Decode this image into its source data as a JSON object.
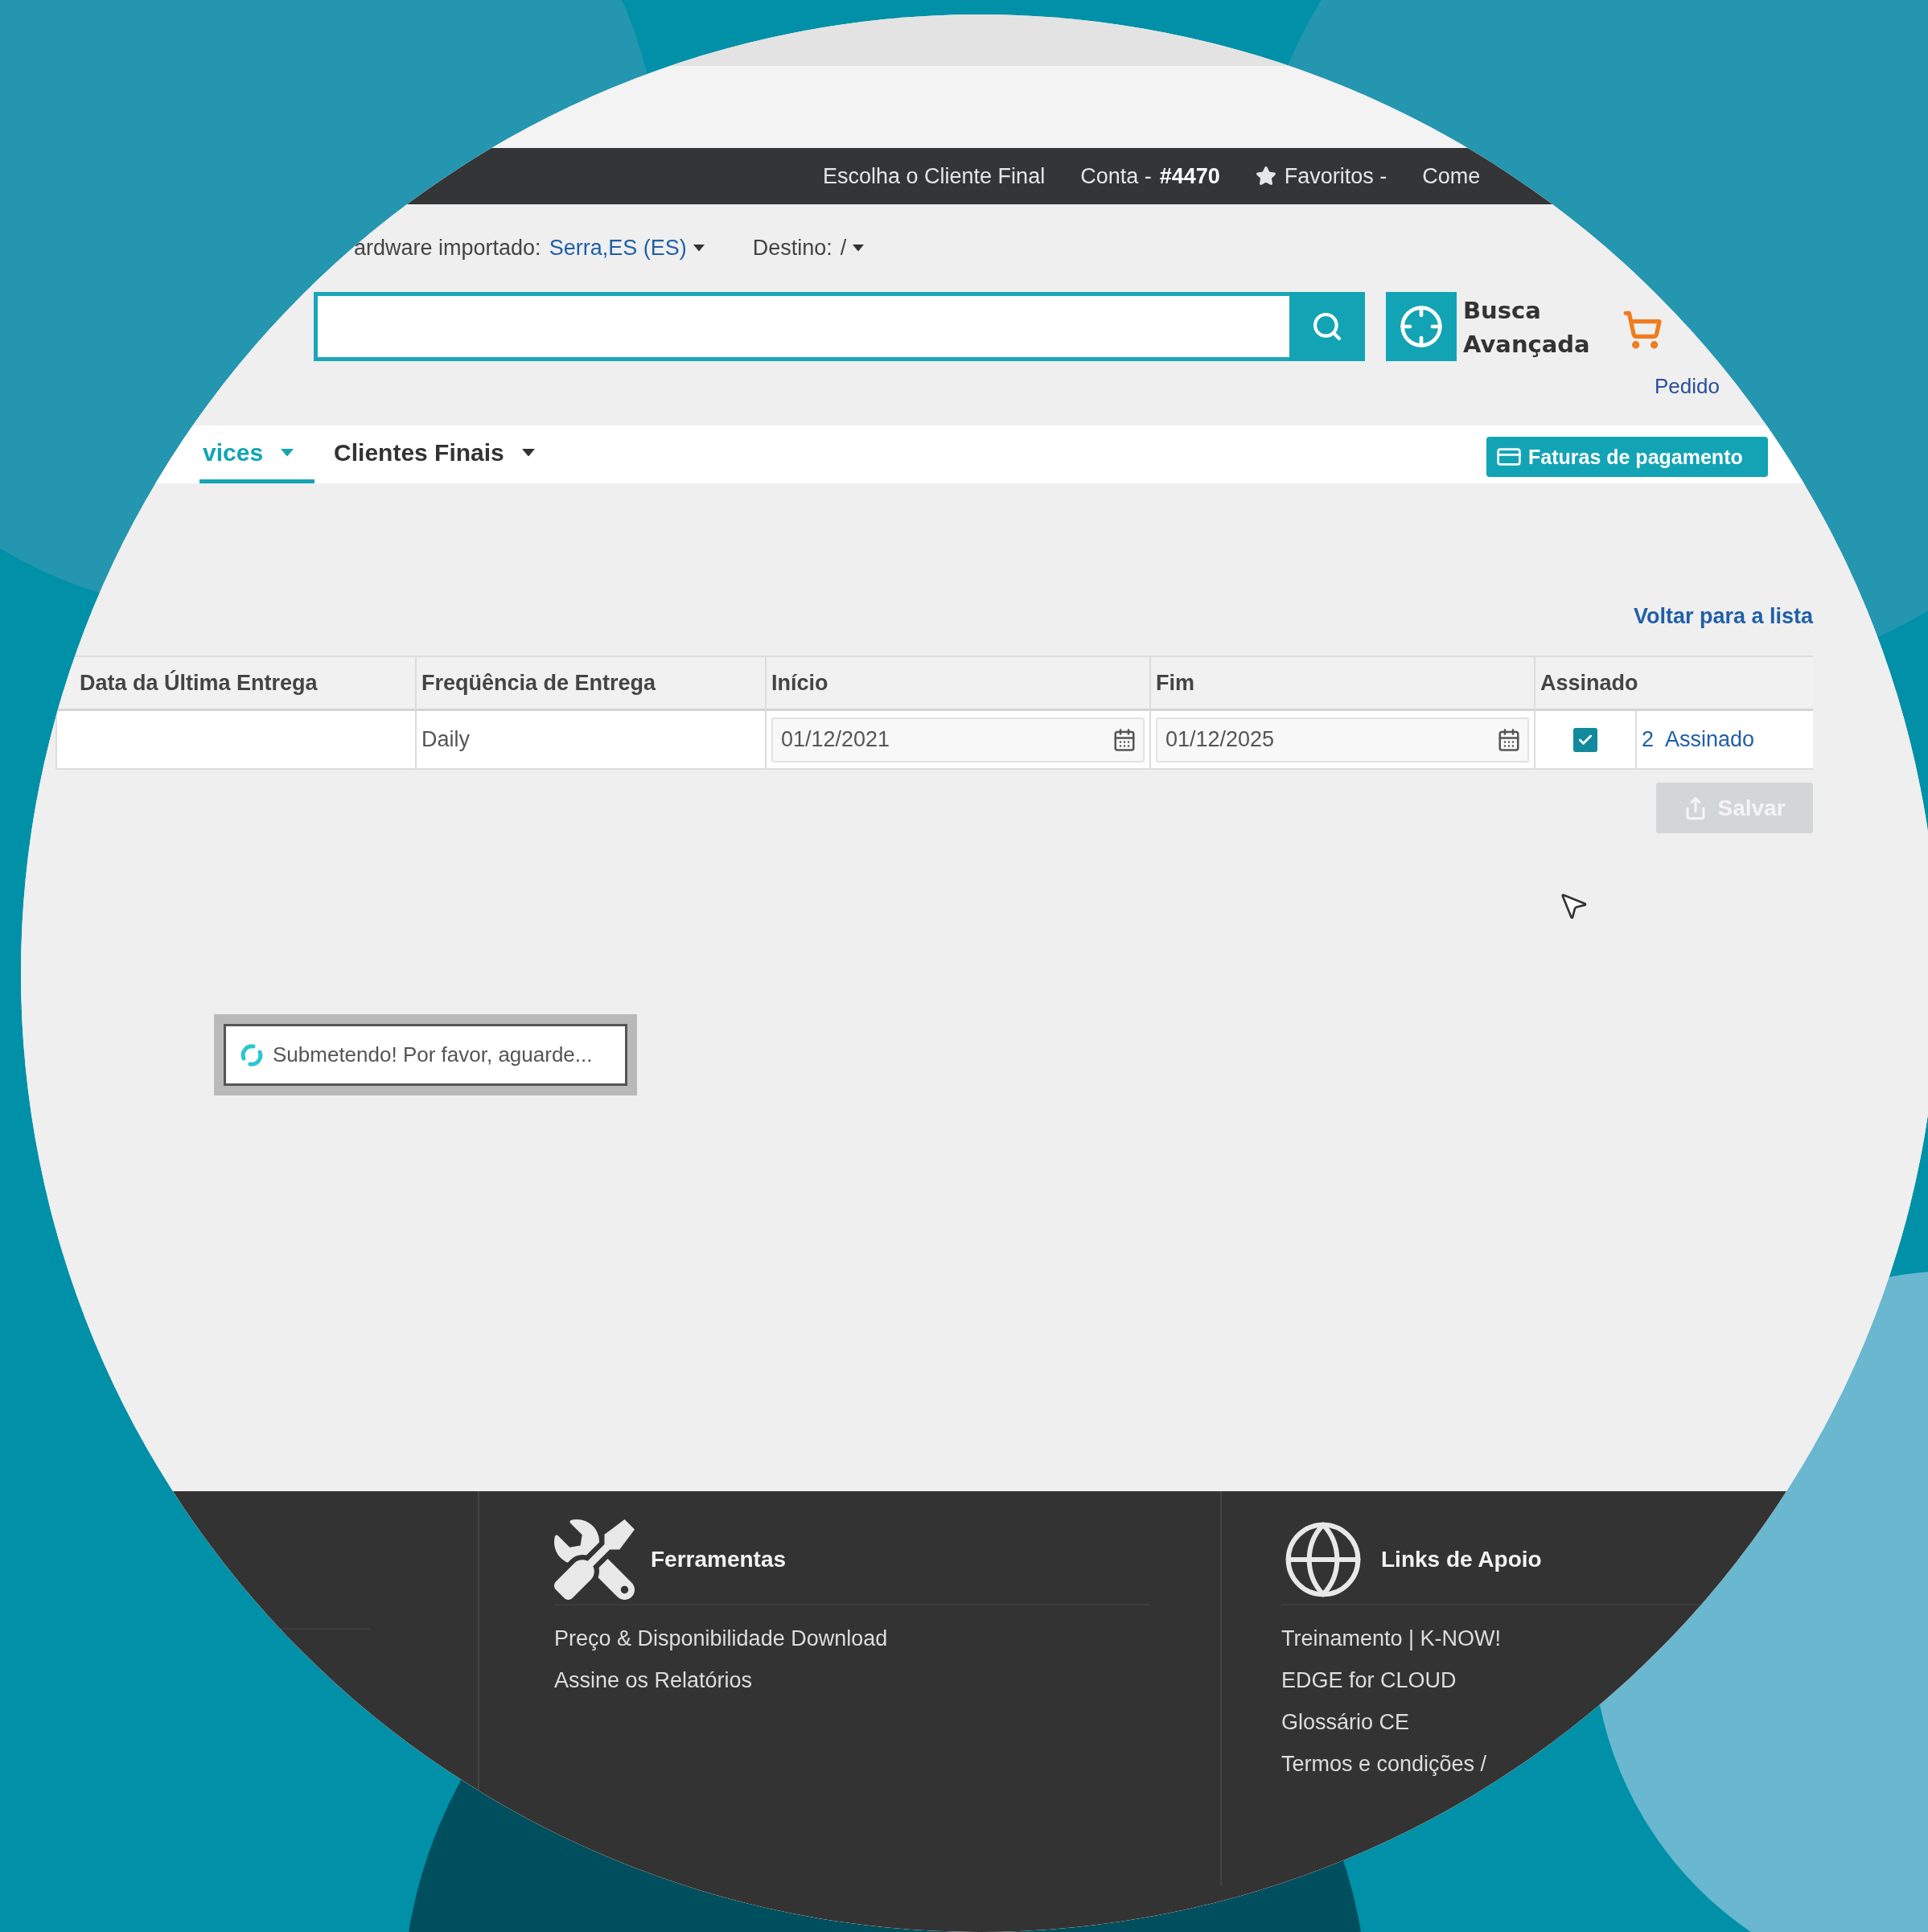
{
  "top_bar": {
    "items": [
      {
        "kind": "link",
        "label": "Escolha o Cliente Final"
      },
      {
        "kind": "account",
        "label": "Conta -",
        "value": "#4470"
      },
      {
        "kind": "favorites",
        "label": "Favoritos -"
      },
      {
        "kind": "link",
        "label": "Come"
      }
    ]
  },
  "location_bar": {
    "hardware_label": "ardware importado:",
    "hardware_value": "Serra,ES (ES)",
    "destination_label": "Destino:",
    "destination_value": "/"
  },
  "search": {
    "advanced_label": "Busca Avançada"
  },
  "cart": {
    "label": "Pedido"
  },
  "nav": {
    "tabs": [
      {
        "label": "vices",
        "selected": true
      },
      {
        "label": "Clientes Finais",
        "selected": false
      }
    ],
    "invoices_button": "Faturas de pagamento"
  },
  "back_link": "Voltar para a lista",
  "table": {
    "columns": [
      "Data da Última Entrega",
      "Freqüência de Entrega",
      "Início",
      "Fim",
      "Assinado"
    ],
    "rows": [
      {
        "frequency": "Daily",
        "start": "01/12/2021",
        "end": "01/12/2025",
        "signed": true,
        "signed_count": "2",
        "signed_label": "Assinado"
      }
    ]
  },
  "save_button": {
    "label": "Salvar",
    "disabled": true
  },
  "loading_dialog": {
    "message": "Submetendo! Por favor, aguarde..."
  },
  "footer": {
    "columns": [
      {
        "kind": "tools",
        "title": "Ferramentas",
        "links": [
          "Preço & Disponibilidade Download",
          "Assine os Relatórios"
        ]
      },
      {
        "kind": "support",
        "title": "Links de Apoio",
        "links": [
          "Treinamento | K-NOW!",
          "EDGE for CLOUD",
          "Glossário CE",
          "Termos e condições /"
        ]
      }
    ]
  }
}
